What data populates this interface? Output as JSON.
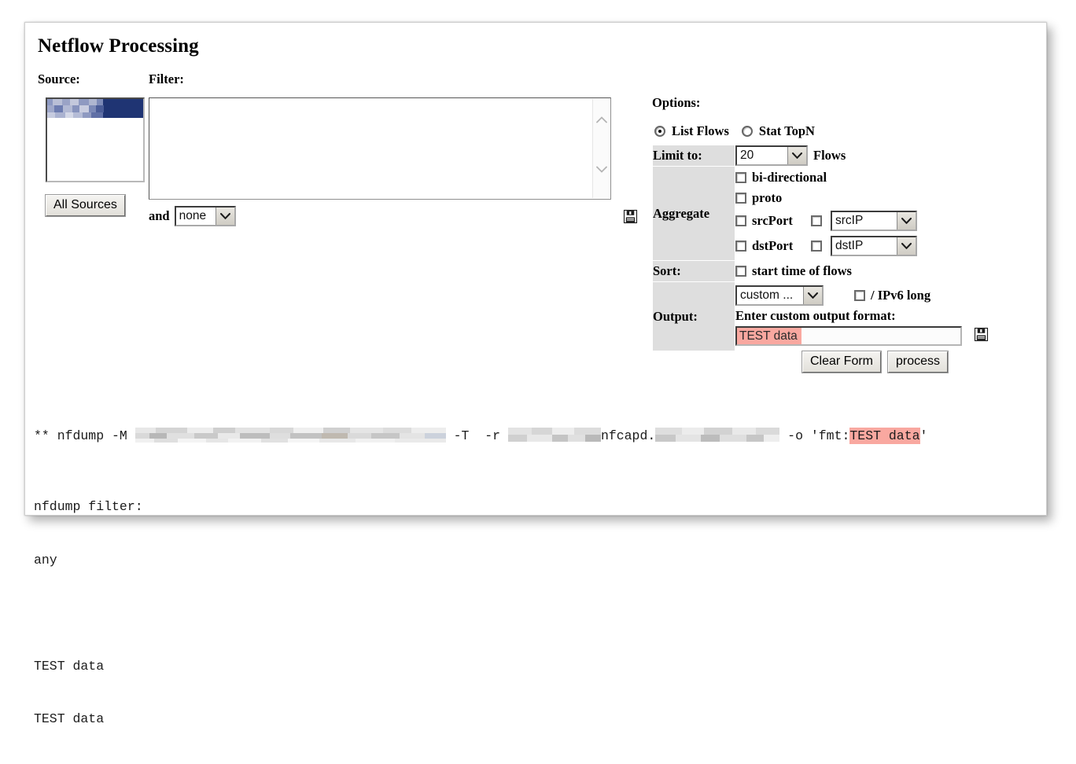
{
  "page": {
    "title": "Netflow Processing"
  },
  "source": {
    "label": "Source:",
    "selected_item_redacted": true,
    "all_sources_button": "All Sources"
  },
  "filter": {
    "label": "Filter:",
    "textarea_value": "",
    "and_label": "and",
    "and_select_value": "none",
    "save_icon": "floppy-save-icon",
    "scroll_up_icon": "chevron-up-icon",
    "scroll_down_icon": "chevron-down-icon"
  },
  "options": {
    "label": "Options:",
    "mode": {
      "list_flows": "List Flows",
      "list_flows_selected": true,
      "stat_topn": "Stat TopN",
      "stat_topn_selected": false
    },
    "limit": {
      "label": "Limit to:",
      "value": "20",
      "unit": "Flows"
    },
    "aggregate": {
      "label": "Aggregate",
      "bidirectional": "bi-directional",
      "proto": "proto",
      "src_port": "srcPort",
      "dst_port": "dstPort",
      "src_ip_select": "srcIP",
      "dst_ip_select": "dstIP"
    },
    "sort": {
      "label": "Sort:",
      "start_time": "start time of flows"
    },
    "output": {
      "label": "Output:",
      "format_select": "custom ...",
      "ipv6_long": "/ IPv6 long",
      "custom_prompt": "Enter custom output format:",
      "custom_value": "TEST data",
      "save_icon": "floppy-save-icon"
    }
  },
  "buttons": {
    "clear_form": "Clear Form",
    "process": "process"
  },
  "console": {
    "cmd_prefix": "** nfdump -M ",
    "cmd_mid": " -T  -r ",
    "cmd_nfcapd": "nfcapd.",
    "cmd_output_flag": " -o 'fmt:",
    "cmd_output_value": "TEST data",
    "cmd_output_tail": "'",
    "filter_line": "nfdump filter:",
    "filter_value": "any",
    "blank_line": "",
    "result_line_1": "TEST data",
    "result_line_2": "TEST data"
  },
  "colors": {
    "highlight": "#f9a8a0",
    "selection": "#1f3473",
    "label_cell": "#dedede",
    "panel_border": "#cfcfcf"
  }
}
